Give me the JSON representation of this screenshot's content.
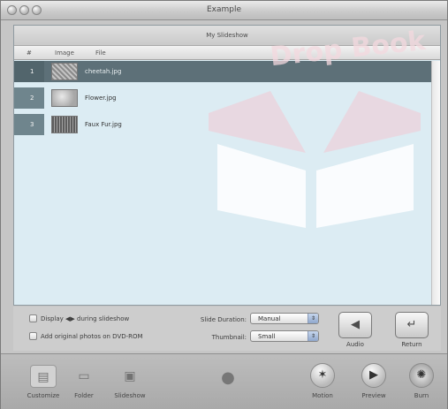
{
  "window": {
    "title": "Example"
  },
  "slideshow": {
    "title": "My Slideshow"
  },
  "table": {
    "headers": {
      "num": "#",
      "image": "Image",
      "file": "File"
    },
    "rows": [
      {
        "num": "1",
        "file": "cheetah.jpg",
        "selected": true
      },
      {
        "num": "2",
        "file": "Flower.jpg",
        "selected": false
      },
      {
        "num": "3",
        "file": "Faux Fur.jpg",
        "selected": false
      }
    ]
  },
  "controls": {
    "display_label": "Display ◀▶ during slideshow",
    "add_originals_label": "Add original photos on DVD-ROM",
    "slide_duration_label": "Slide Duration:",
    "slide_duration_value": "Manual",
    "thumbnail_label": "Thumbnail:",
    "thumbnail_value": "Small",
    "audio_label": "Audio",
    "return_label": "Return"
  },
  "toolbar": {
    "customize": "Customize",
    "folder": "Folder",
    "slideshow": "Slideshow",
    "motion": "Motion",
    "preview": "Preview",
    "burn": "Burn"
  },
  "watermark": {
    "text": "Drop Book"
  }
}
